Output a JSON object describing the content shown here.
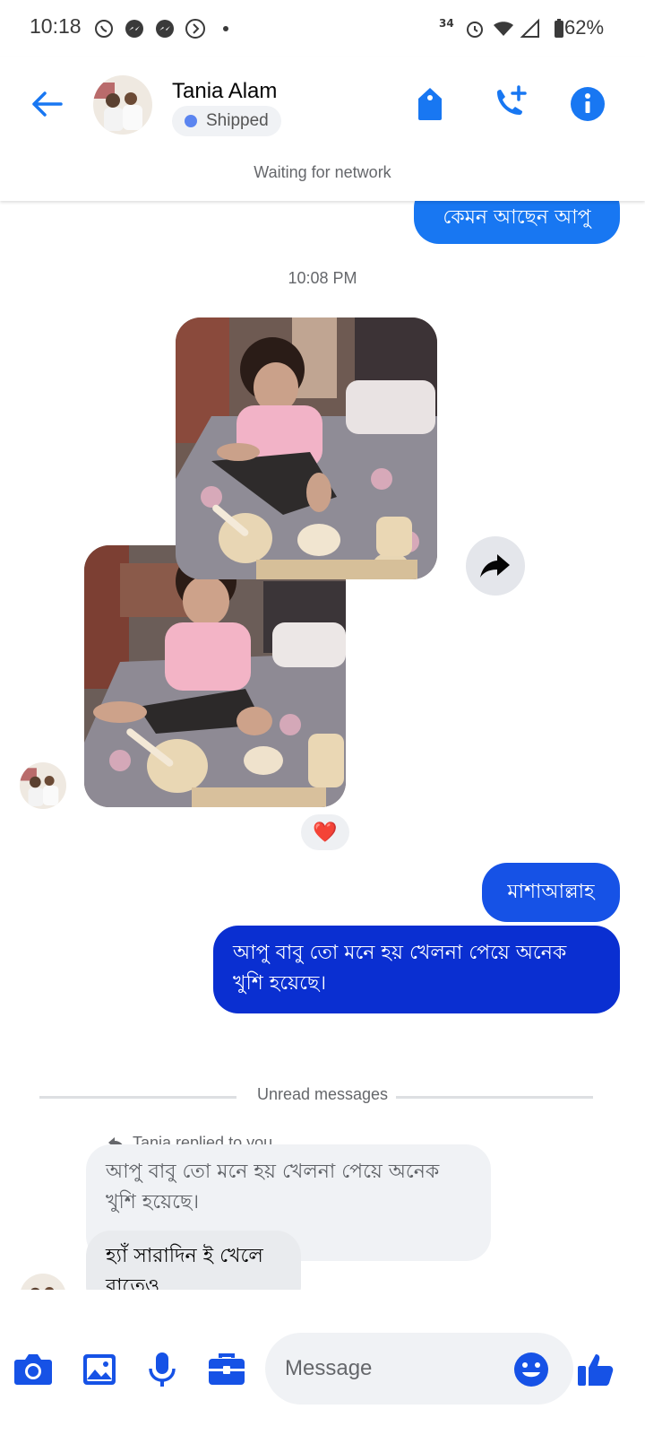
{
  "status_bar": {
    "time": "10:18",
    "network_badge": "34",
    "battery": "62%",
    "icons": [
      "whatsapp-icon",
      "messenger-icon",
      "messenger-icon",
      "play-icon",
      "dot-icon",
      "data-badge-icon",
      "alarm-icon",
      "wifi-icon",
      "signal-icon",
      "battery-icon"
    ]
  },
  "header": {
    "contact_name": "Tania Alam",
    "status_chip": "Shipped",
    "network_status": "Waiting for network",
    "accent": "#1877f2"
  },
  "messages": {
    "top_outgoing": "কেমন আছেন আপু",
    "timestamp": "10:08 PM",
    "reaction": "❤️",
    "outgoing_1": "মাশাআল্লাহ",
    "outgoing_2_line1": "আপু বাবু তো মনে হয় খেলনা পেয়ে অনেক",
    "outgoing_2_line2": "খুশি হয়েছে।",
    "unread_divider": "Unread messages",
    "reply_note": "Tania replied to you",
    "quoted_line1": "আপু বাবু তো মনে হয় খেলনা পেয়ে অনেক",
    "quoted_line2": "খুশি হয়েছে।",
    "incoming_line1": "হ্যাঁ সারাদিন ই  খেলে",
    "incoming_line2": "রাতেও"
  },
  "colors": {
    "outgoing_blue": "#1877f2",
    "outgoing_dark_blue": "#0a2fd1",
    "incoming_bg": "#eef0f3"
  },
  "composer": {
    "placeholder": "Message"
  }
}
